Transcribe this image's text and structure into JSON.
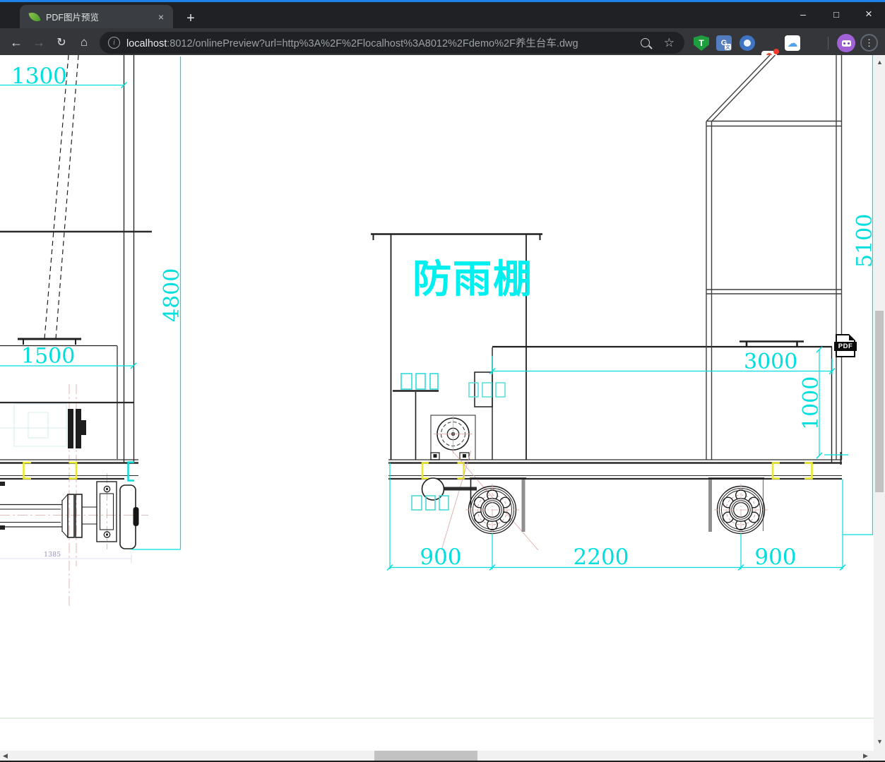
{
  "browser": {
    "tab": {
      "title": "PDF图片预览",
      "close_glyph": "×"
    },
    "new_tab_glyph": "+",
    "window_controls": {
      "minimize": "–",
      "maximize": "□",
      "close": "×"
    },
    "nav": {
      "back": "←",
      "forward": "→",
      "reload": "↻",
      "home": "⌂"
    },
    "omnibox": {
      "info_glyph": "i",
      "host": "localhost",
      "path": ":8012/onlinePreview?url=http%3A%2F%2Flocalhost%3A8012%2Fdemo%2F养生台车.dwg",
      "bookmark_glyph": "☆"
    },
    "extensions": {
      "tampermonkey": "T",
      "translate": "G",
      "translate_sub": "文",
      "cloud_glyph": "☁"
    },
    "menu_dots": "⋮"
  },
  "viewer": {
    "pdf_button": "PDF",
    "drawing": {
      "shelter_label": "防雨棚",
      "dim_1300": "1300",
      "dim_4800": "4800",
      "dim_1500": "1500",
      "dim_1385": "1385",
      "dim_3000": "3000",
      "dim_1000": "1000",
      "dim_5100": "5100",
      "dim_900_left": "900",
      "dim_2200": "2200",
      "dim_900_right": "900"
    }
  },
  "scrollbar": {
    "up": "▲",
    "down": "▼",
    "left": "◀",
    "right": "▶"
  },
  "colors": {
    "accent_blue": "#2080ea",
    "cad_cyan": "#00dede",
    "cad_yellow": "#e9e92c",
    "cad_pink": "#dda4a4"
  }
}
